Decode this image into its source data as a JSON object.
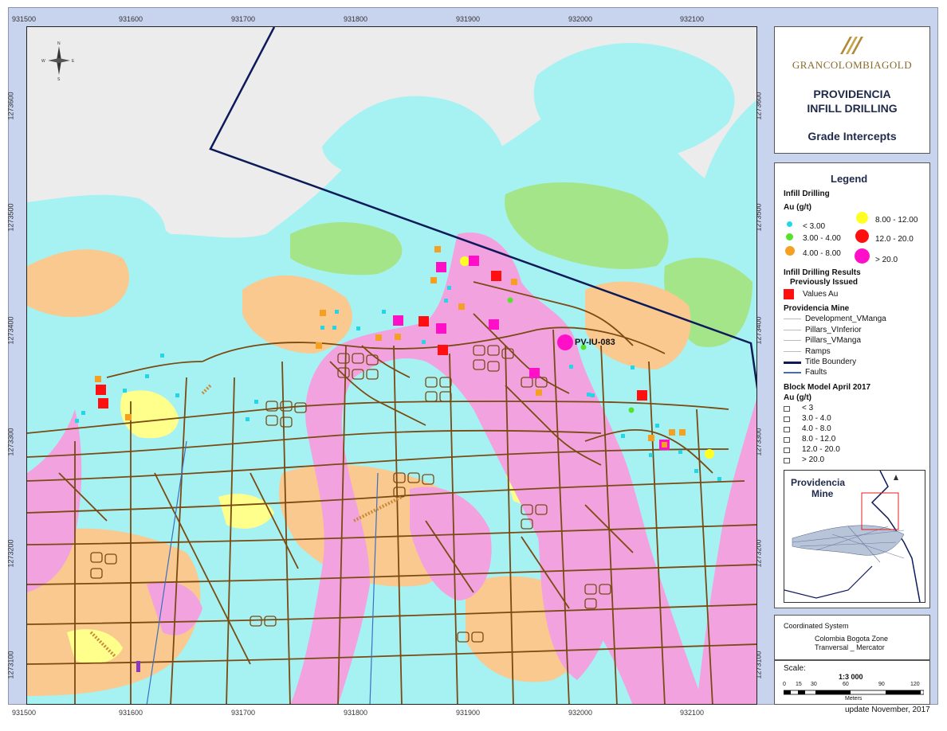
{
  "map": {
    "top_x_ticks": [
      "931500",
      "931600",
      "931700",
      "931800",
      "931900",
      "932000",
      "932100"
    ],
    "bottom_x_ticks": [
      "931500",
      "931600",
      "931700",
      "931800",
      "931900",
      "932000",
      "932100"
    ],
    "left_y_ticks": [
      "1273600",
      "1273500",
      "1273400",
      "1273300",
      "1273200",
      "1273100"
    ],
    "right_y_ticks": [
      "1273600",
      "1273500",
      "1273400",
      "1273300",
      "1273200",
      "1273100"
    ],
    "drillhole_label": "PV-IU-083",
    "north_arrow": "north-arrow-icon",
    "colors": {
      "cyan": "#a6f2f2",
      "green": "#a5e58a",
      "yellow": "#ffff8c",
      "orange": "#f9c98f",
      "pink": "#f2a2df",
      "workings": "#7a4a12",
      "boundary": "#0c1a5a"
    }
  },
  "title_box": {
    "logo_text": "GRANCOLOMBIAGOLD",
    "title_line1": "PROVIDENCIA",
    "title_line2": "INFILL DRILLING",
    "subtitle": "Grade Intercepts"
  },
  "legend": {
    "heading": "Legend",
    "infill_heading": "Infill Drilling",
    "au_heading": "Au (g/t)",
    "classes": [
      {
        "label": "< 3.00",
        "color": "#22d6e8"
      },
      {
        "label": "3.00 - 4.00",
        "color": "#55e22a"
      },
      {
        "label": "4.00 - 8.00",
        "color": "#f5a020"
      },
      {
        "label": "8.00 - 12.00",
        "color": "#ffff22"
      },
      {
        "label": "12.0 - 20.0",
        "color": "#ff1010"
      },
      {
        "label": "> 20.0",
        "color": "#ff10c8"
      }
    ],
    "results_heading1": "Infill Drilling Results",
    "results_heading2": "Previously Issued",
    "values_label": "Values Au",
    "mine_heading": "Providencia Mine",
    "mine_items": [
      "Development_VManga",
      "Pillars_VInferior",
      "Pillars_VManga",
      "Ramps"
    ],
    "title_boundary": "Title Boundery",
    "faults": "Faults",
    "block_heading1": "Block Model April 2017",
    "block_heading2": "Au (g/t)",
    "block_items": [
      "< 3",
      "3.0 - 4.0",
      "4.0 - 8.0",
      "8.0 - 12.0",
      "12.0 - 20.0",
      "> 20.0"
    ],
    "inset_title1": "Providencia",
    "inset_title2": "Mine"
  },
  "coords": {
    "heading": "Coordinated System",
    "line1": "Colombia Bogota Zone",
    "line2": "Tranversal _ Mercator"
  },
  "scale": {
    "label": "Scale:",
    "ratio": "1:3 000",
    "ticks": [
      "0",
      "15",
      "30",
      "60",
      "90",
      "120"
    ],
    "unit": "Meters"
  },
  "update_note": "update November, 2017"
}
